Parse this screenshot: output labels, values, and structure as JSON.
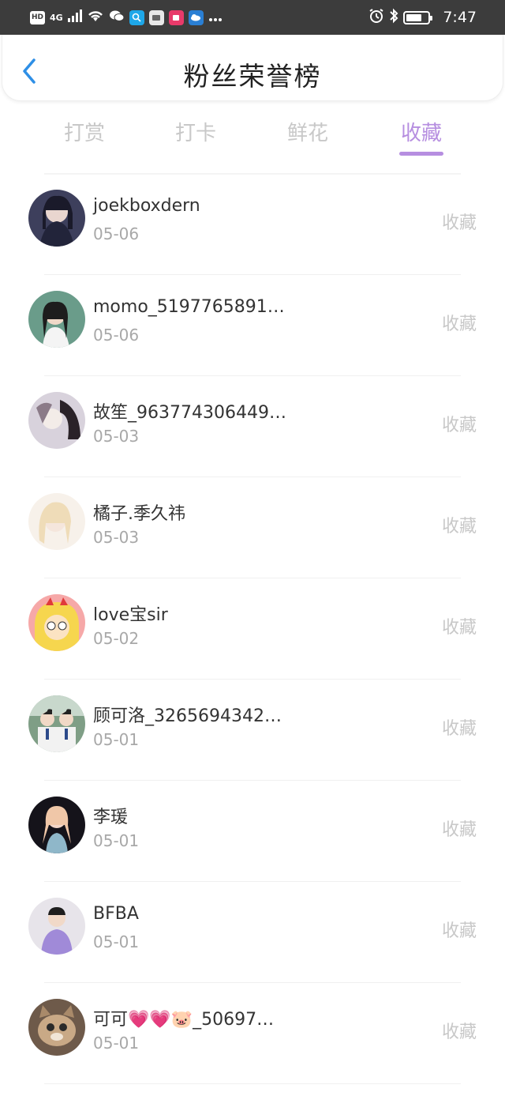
{
  "status_bar": {
    "hd": "HD",
    "signal": "4G",
    "time": "7:47",
    "battery_level": 0.7
  },
  "header": {
    "title": "粉丝荣誉榜"
  },
  "tabs": [
    {
      "label": "打赏",
      "active": false
    },
    {
      "label": "打卡",
      "active": false
    },
    {
      "label": "鲜花",
      "active": false
    },
    {
      "label": "收藏",
      "active": true
    }
  ],
  "fans": [
    {
      "name": "joekboxdern",
      "date": "05-06",
      "action": "收藏",
      "avatar_color": "#3d3f5c"
    },
    {
      "name": "momo_5197765891…",
      "date": "05-06",
      "action": "收藏",
      "avatar_color": "#5f8f7a"
    },
    {
      "name": "故笙_963774306449…",
      "date": "05-03",
      "action": "收藏",
      "avatar_color": "#c9c2d2"
    },
    {
      "name": "橘子.季久祎",
      "date": "05-03",
      "action": "收藏",
      "avatar_color": "#f0e4d4"
    },
    {
      "name": "love宝sir",
      "date": "05-02",
      "action": "收藏",
      "avatar_color": "#f4d25a"
    },
    {
      "name": "顾可洛_3265694342…",
      "date": "05-01",
      "action": "收藏",
      "avatar_color": "#6d8a74"
    },
    {
      "name": "李瑗",
      "date": "05-01",
      "action": "收藏",
      "avatar_color": "#1d1b22"
    },
    {
      "name": "BFBA",
      "date": "05-01",
      "action": "收藏",
      "avatar_color": "#b9a7d6"
    },
    {
      "name": "可可💗💗🐷_50697…",
      "date": "05-01",
      "action": "收藏",
      "avatar_color": "#8a6f58"
    }
  ],
  "colors": {
    "accent": "#b68ee0",
    "back_arrow": "#2e8fe6",
    "status_bar": "#3c3c3c"
  }
}
